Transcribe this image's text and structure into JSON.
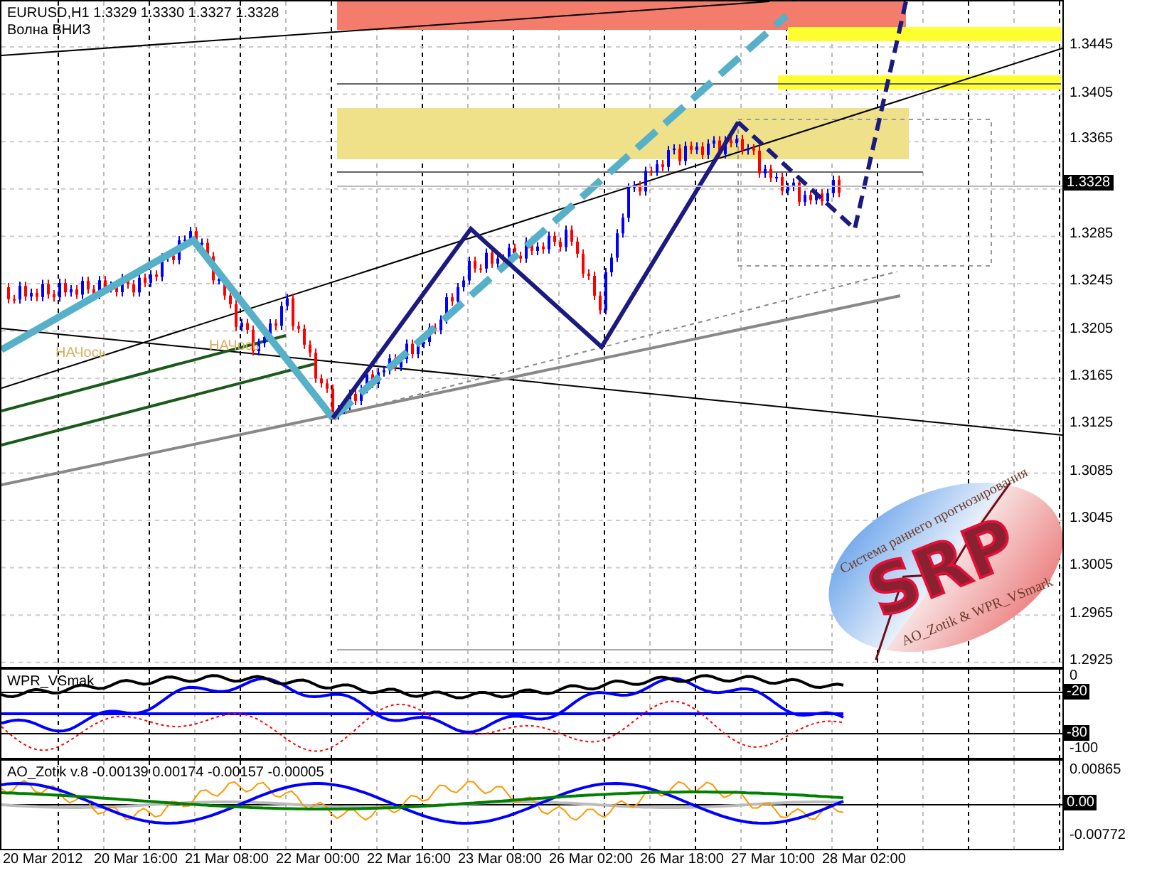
{
  "main_chart": {
    "symbol_line": "EURUSD,H1  1.3329 1.3330 1.3327 1.3328",
    "caption": "Волна ВНИЗ",
    "markers": [
      {
        "text": "НАЧось"
      },
      {
        "text": "НАЧось"
      }
    ],
    "price_ticks": [
      {
        "text": "1.3445",
        "kind": "plain"
      },
      {
        "text": "1.3405",
        "kind": "plain"
      },
      {
        "text": "1.3365",
        "kind": "plain"
      },
      {
        "text": "1.3328",
        "kind": "badge"
      },
      {
        "text": "1.3285",
        "kind": "plain"
      },
      {
        "text": "1.3245",
        "kind": "plain"
      },
      {
        "text": "1.3205",
        "kind": "plain"
      },
      {
        "text": "1.3165",
        "kind": "plain"
      },
      {
        "text": "1.3125",
        "kind": "plain"
      },
      {
        "text": "1.3085",
        "kind": "plain"
      },
      {
        "text": "1.3045",
        "kind": "plain"
      },
      {
        "text": "1.3005",
        "kind": "plain"
      },
      {
        "text": "1.2965",
        "kind": "plain"
      },
      {
        "text": "1.2925",
        "kind": "plain"
      }
    ]
  },
  "logo": {
    "arc_text": "Система раннего прогнозирования",
    "mark": "SRP",
    "credit": "AO_Zotik & WPR_VSmark"
  },
  "wpr_panel": {
    "title": "WPR_VSmak",
    "ticks": [
      {
        "text": "0",
        "kind": "plain"
      },
      {
        "text": "-20",
        "kind": "badge"
      },
      {
        "text": "-80",
        "kind": "badge"
      },
      {
        "text": "-100",
        "kind": "plain"
      }
    ]
  },
  "ao_panel": {
    "title": "AO_Zotik v.8 -0.00139 0.00174 -0.00157 -0.00005",
    "ticks": [
      {
        "text": "0.00865",
        "kind": "plain"
      },
      {
        "text": "0.00",
        "kind": "badge"
      },
      {
        "text": "-0.00772",
        "kind": "plain"
      }
    ]
  },
  "time_axis": [
    "20 Mar 2012",
    "20 Mar 16:00",
    "21 Mar 08:00",
    "22 Mar 00:00",
    "22 Mar 16:00",
    "23 Mar 08:00",
    "26 Mar 02:00",
    "26 Mar 18:00",
    "27 Mar 10:00",
    "28 Mar 02:00"
  ]
}
